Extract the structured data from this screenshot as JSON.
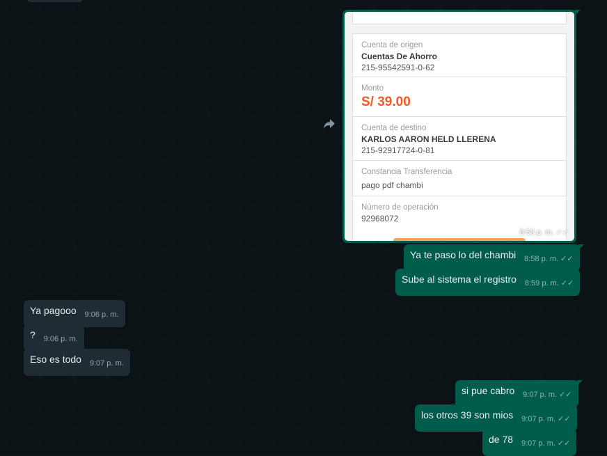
{
  "receipt": {
    "origin_label": "Cuenta de origen",
    "origin_name": "Cuentas De Ahorro",
    "origin_number": "215-95542591-0-62",
    "amount_label": "Monto",
    "amount_value": "S/ 39.00",
    "dest_label": "Cuenta de destino",
    "dest_name": "KARLOS AARON HELD LLERENA",
    "dest_number": "215-92917724-0-81",
    "note_label": "Constancia Transferencia",
    "note_value": "pago pdf chambi",
    "op_label": "Número de operación",
    "op_value": "92968072"
  },
  "image_message": {
    "time": "8:58 p. m."
  },
  "messages": [
    {
      "direction": "out",
      "text": "Ya te paso lo del chambi",
      "time": "8:58 p. m."
    },
    {
      "direction": "out",
      "text": "Sube al sistema el registro",
      "time": "8:59 p. m."
    },
    {
      "direction": "in",
      "text": "Ya pagooo",
      "time": "9:06 p. m."
    },
    {
      "direction": "in",
      "text": "?",
      "time": "9:06 p. m."
    },
    {
      "direction": "in",
      "text": "Eso es todo",
      "time": "9:07 p. m."
    },
    {
      "direction": "out",
      "text": "si pue cabro",
      "time": "9:07 p. m."
    },
    {
      "direction": "out",
      "text": "los otros 39 son mios",
      "time": "9:07 p. m."
    },
    {
      "direction": "out",
      "text": "de 78",
      "time": "9:07 p. m."
    }
  ],
  "icons": {
    "forward": "forward-icon",
    "read_ticks": "double-check-icon"
  },
  "colors": {
    "outgoing_bubble": "#005c4b",
    "incoming_bubble": "#202c33",
    "chat_background": "#0b1316",
    "amount_accent": "#f15a22"
  }
}
